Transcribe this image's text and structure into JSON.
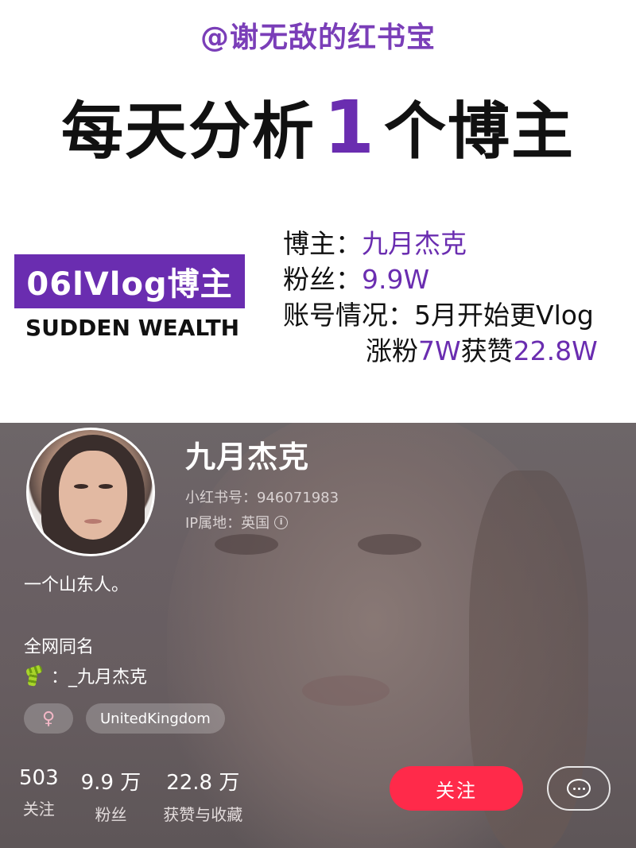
{
  "banner": {
    "handle": "@谢无敌的红书宝",
    "headline_pre": "每天分析",
    "headline_num": "1",
    "headline_post": "个博主",
    "tag": "06lVlog博主",
    "subtitle_en": "SUDDEN WEALTH",
    "info": {
      "blogger_label": "博主：",
      "blogger_value": "九月杰克",
      "fans_label": "粉丝：",
      "fans_value": "9.9W",
      "account_label": "账号情况：",
      "account_value": "5月开始更Vlog",
      "gain_pre": "涨粉",
      "gain_fans": "7W",
      "gain_mid": "获赞",
      "gain_likes": "22.8W"
    }
  },
  "profile": {
    "name": "九月杰克",
    "id_line": "小红书号：946071983",
    "ip_line": "IP属地：英国",
    "bio": "一个山东人。",
    "bio_line2": "全网同名",
    "bio_line3": "：_九月杰克",
    "gender_symbol": "♀",
    "location_tag": "UnitedKingdom",
    "stats": [
      {
        "num": "503",
        "label": "关注"
      },
      {
        "num": "9.9 万",
        "label": "粉丝"
      },
      {
        "num": "22.8 万",
        "label": "获赞与收藏"
      }
    ],
    "follow_label": "关注",
    "colors": {
      "accent": "#6a2db0",
      "follow": "#ff2a4a"
    }
  }
}
